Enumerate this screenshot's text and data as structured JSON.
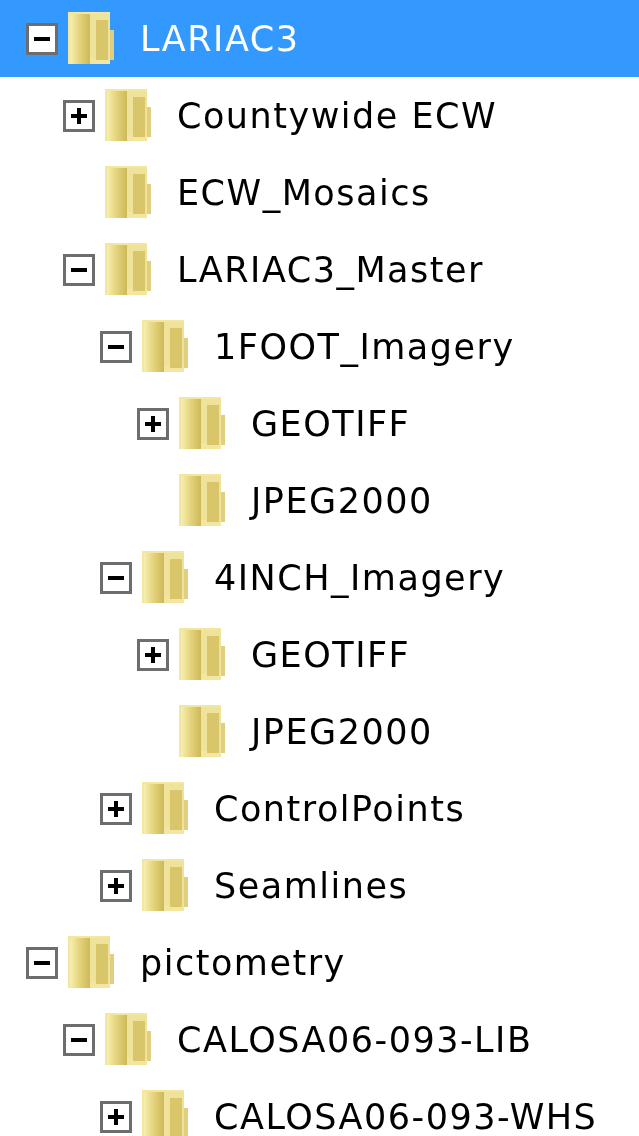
{
  "tree": [
    {
      "label": "LARIAC3",
      "kind": "branch",
      "expanded": true,
      "selected": true,
      "children": [
        {
          "label": "Countywide ECW",
          "kind": "branch",
          "expanded": false,
          "selected": false
        },
        {
          "label": "ECW_Mosaics",
          "kind": "leaf",
          "selected": false
        },
        {
          "label": "LARIAC3_Master",
          "kind": "branch",
          "expanded": true,
          "selected": false,
          "children": [
            {
              "label": "1FOOT_Imagery",
              "kind": "branch",
              "expanded": true,
              "selected": false,
              "children": [
                {
                  "label": "GEOTIFF",
                  "kind": "branch",
                  "expanded": false,
                  "selected": false
                },
                {
                  "label": "JPEG2000",
                  "kind": "leaf",
                  "selected": false
                }
              ]
            },
            {
              "label": "4INCH_Imagery",
              "kind": "branch",
              "expanded": true,
              "selected": false,
              "children": [
                {
                  "label": "GEOTIFF",
                  "kind": "branch",
                  "expanded": false,
                  "selected": false
                },
                {
                  "label": "JPEG2000",
                  "kind": "leaf",
                  "selected": false
                }
              ]
            },
            {
              "label": "ControlPoints",
              "kind": "branch",
              "expanded": false,
              "selected": false
            },
            {
              "label": "Seamlines",
              "kind": "branch",
              "expanded": false,
              "selected": false
            }
          ]
        }
      ]
    },
    {
      "label": "pictometry",
      "kind": "branch",
      "expanded": true,
      "selected": false,
      "children": [
        {
          "label": "CALOSA06-093-LIB",
          "kind": "branch",
          "expanded": true,
          "selected": false,
          "children": [
            {
              "label": "CALOSA06-093-WHS",
              "kind": "branch",
              "expanded": false,
              "selected": false
            }
          ]
        }
      ]
    }
  ]
}
